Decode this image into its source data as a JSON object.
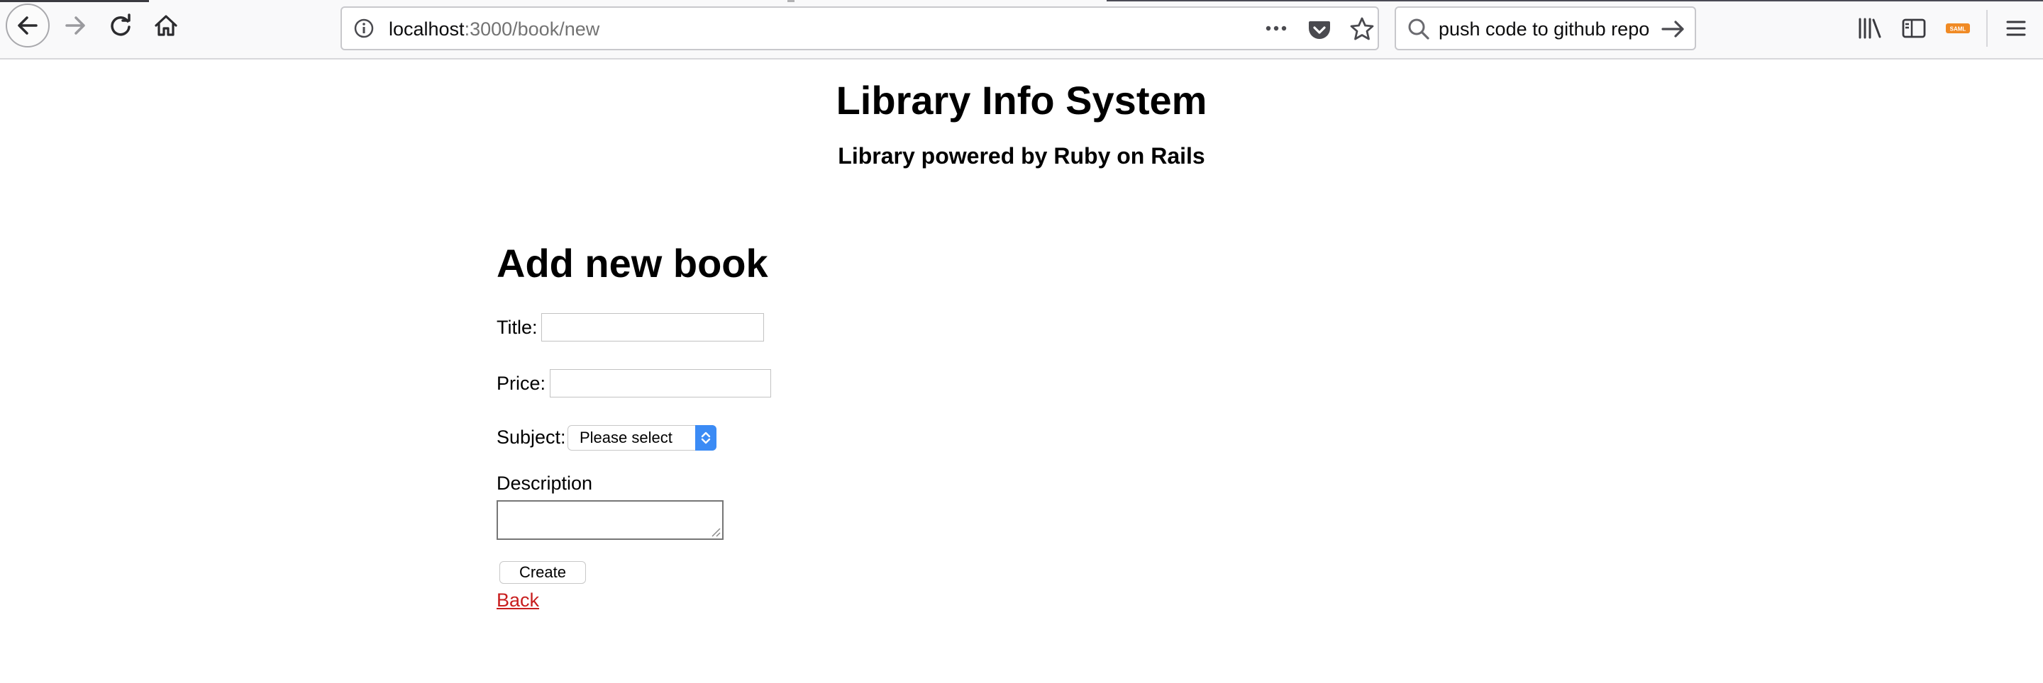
{
  "browser": {
    "url": {
      "host": "localhost",
      "rest": ":3000/book/new"
    },
    "search": {
      "value": "push code to github repo"
    },
    "saml_badge": "SAML",
    "colors": {
      "toolbar_bg": "#f9f9fa",
      "accent_select": "#3b8bf5",
      "link": "#c81e1e"
    }
  },
  "page": {
    "site_title": "Library Info System",
    "site_subtitle": "Library powered by Ruby on Rails",
    "heading": "Add new book",
    "form": {
      "title_label": "Title:",
      "title_value": "",
      "price_label": "Price:",
      "price_value": "",
      "subject_label": "Subject:",
      "subject_selected": "Please select",
      "description_label": "Description",
      "description_value": "",
      "create_label": "Create"
    },
    "back_link": "Back"
  },
  "icons": [
    "back-arrow-icon",
    "forward-arrow-icon",
    "reload-icon",
    "home-icon",
    "info-icon",
    "more-dots-icon",
    "pocket-icon",
    "star-icon",
    "search-icon",
    "go-arrow-icon",
    "library-icon",
    "sidebar-icon",
    "saml-icon",
    "hamburger-menu-icon",
    "select-arrows-icon",
    "resize-grip-icon"
  ]
}
